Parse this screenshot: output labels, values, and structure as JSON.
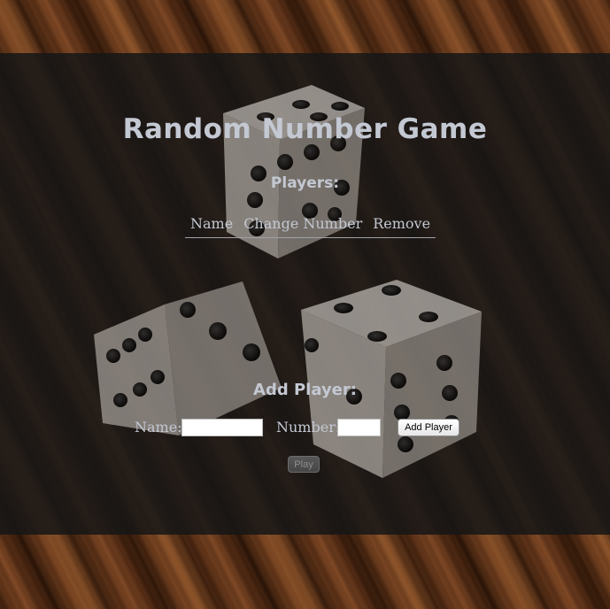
{
  "title": "Random Number Game",
  "players": {
    "heading": "Players:",
    "columns": [
      "Name",
      "Change Number",
      "Remove"
    ],
    "rows": []
  },
  "add_player": {
    "heading": "Add Player:",
    "name_label": "Name:",
    "name_value": "",
    "number_label": "Number:",
    "number_value": "",
    "add_button": "Add Player"
  },
  "play_button": "Play",
  "background": {
    "image": "wooden-table-with-dice",
    "icon": "dice-icon",
    "wood_color": "#5a2f15",
    "overlay_color": "#161616"
  }
}
